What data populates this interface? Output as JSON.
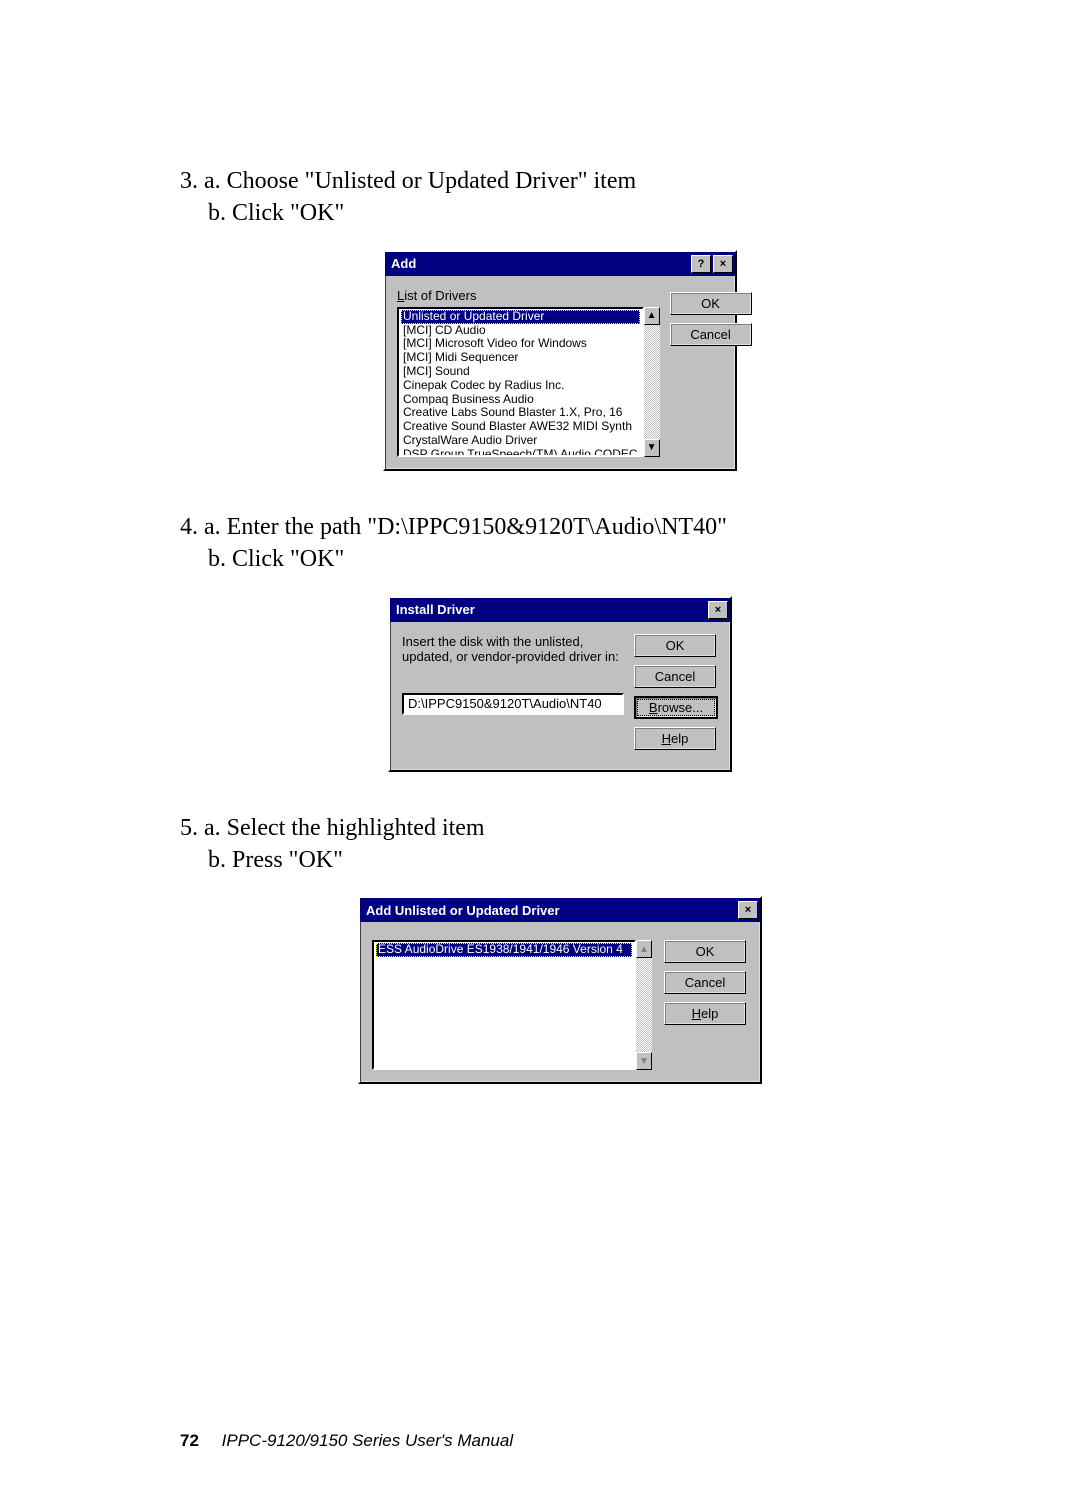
{
  "steps": {
    "s3a": "3. a. Choose \"Unlisted or Updated Driver\" item",
    "s3b": "b. Click \"OK\"",
    "s4a": "4. a. Enter the path \"D:\\IPPC9150&9120T\\Audio\\NT40\"",
    "s4b": "b. Click \"OK\"",
    "s5a": "5. a. Select the highlighted item",
    "s5b": "b. Press \"OK\""
  },
  "dialog1": {
    "title": "Add",
    "list_label": "List of Drivers",
    "items": [
      "Unlisted or Updated Driver",
      "[MCI] CD Audio",
      "[MCI] Microsoft Video for Windows",
      "[MCI] Midi Sequencer",
      "[MCI] Sound",
      "Cinepak Codec by Radius Inc.",
      "Compaq Business Audio",
      "Creative Labs Sound Blaster 1.X, Pro, 16",
      "Creative Sound Blaster AWE32 MIDI Synth",
      "CrystalWare Audio Driver",
      "DSP Group TrueSpeech(TM) Audio CODEC"
    ],
    "ok": "OK",
    "cancel": "Cancel"
  },
  "dialog2": {
    "title": "Install Driver",
    "message": "Insert the disk with the unlisted, updated, or vendor-provided driver in:",
    "path_value": "D:\\IPPC9150&9120T\\Audio\\NT40",
    "ok": "OK",
    "cancel": "Cancel",
    "browse": "Browse...",
    "help": "Help"
  },
  "dialog3": {
    "title": "Add Unlisted or Updated Driver",
    "items": [
      "ESS AudioDrive ES1938/1941/1946 Version 4"
    ],
    "ok": "OK",
    "cancel": "Cancel",
    "help": "Help"
  },
  "footer": {
    "page": "72",
    "text": "IPPC-9120/9150 Series User's Manual"
  },
  "glyphs": {
    "help": "?",
    "close": "×",
    "up": "▲",
    "down": "▼"
  }
}
